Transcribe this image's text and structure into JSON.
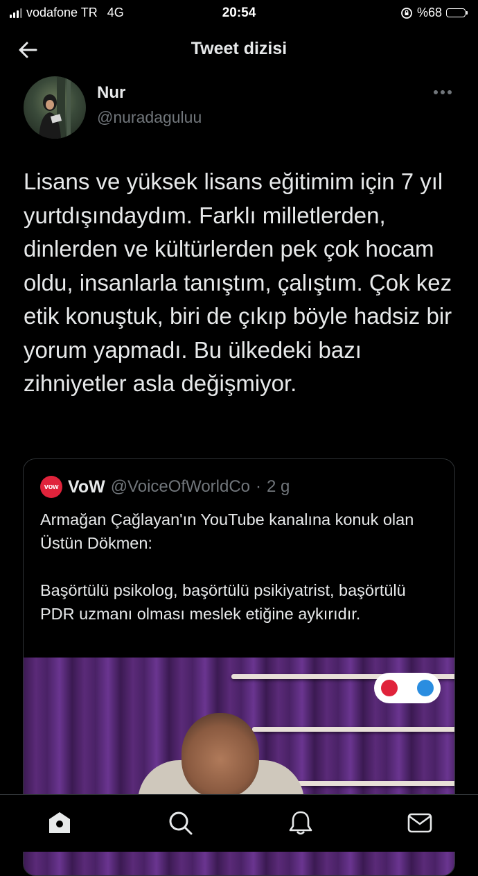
{
  "status_bar": {
    "carrier": "vodafone TR",
    "network": "4G",
    "time": "20:54",
    "battery": "%68",
    "battery_level": 0.68
  },
  "header": {
    "title": "Tweet dizisi"
  },
  "tweet": {
    "author_name": "Nur",
    "author_handle": "@nuradaguluu",
    "text": "Lisans ve yüksek lisans eğitimim için 7 yıl yurtdışındaydım. Farklı milletlerden, dinlerden ve kültürlerden pek çok hocam oldu, insanlarla tanıştım, çalıştım. Çok kez etik konuştuk, biri de çıkıp böyle hadsiz bir yorum yapmadı. Bu ülkedeki bazı zihniyetler asla değişmiyor."
  },
  "quoted_tweet": {
    "avatar_text": "vow",
    "name": "VoW",
    "handle": "@VoiceOfWorldCo",
    "separator": "·",
    "age": "2 g",
    "text": "Armağan Çağlayan'ın YouTube kanalına konuk olan Üstün Dökmen:\n\nBaşörtülü psikolog, başörtülü psikiyatrist, başörtülü PDR uzmanı olması meslek etiğine aykırıdır."
  },
  "colors": {
    "background": "#000000",
    "text": "#e7e9ea",
    "muted": "#71767b",
    "border": "#2f3336",
    "vow_red": "#e0233b"
  },
  "tab_bar": {
    "icons": [
      "home-icon",
      "search-icon",
      "notifications-icon",
      "messages-icon"
    ]
  }
}
